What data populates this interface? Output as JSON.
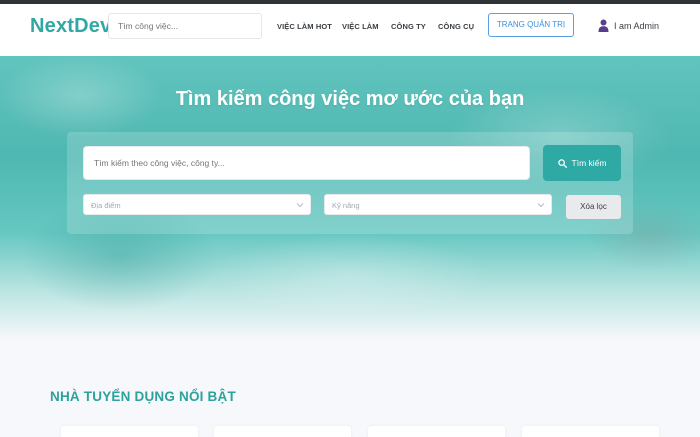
{
  "brand": {
    "logo_text": "NextDev",
    "accent_color": "#31a8a3"
  },
  "navbar": {
    "search_placeholder": "Tìm công việc...",
    "links": [
      {
        "label": "VIỆC LÀM HOT"
      },
      {
        "label": "VIỆC LÀM"
      },
      {
        "label": "CÔNG TY"
      },
      {
        "label": "CÔNG CỤ"
      }
    ],
    "admin_button": "TRANG QUẢN TRỊ",
    "user": {
      "label": "I am Admin",
      "icon": "user-icon"
    }
  },
  "hero": {
    "title": "Tìm kiếm công việc mơ ước của bạn",
    "search_placeholder": "Tìm kiếm theo công việc, công ty...",
    "search_button": "Tìm kiếm",
    "search_button_icon": "search-icon",
    "location_select": {
      "placeholder": "Địa điểm"
    },
    "skill_select": {
      "placeholder": "Kỹ năng"
    },
    "clear_button": "Xóa lọc"
  },
  "featured": {
    "title": "NHÀ TUYỂN DỤNG NỔI BẬT"
  }
}
